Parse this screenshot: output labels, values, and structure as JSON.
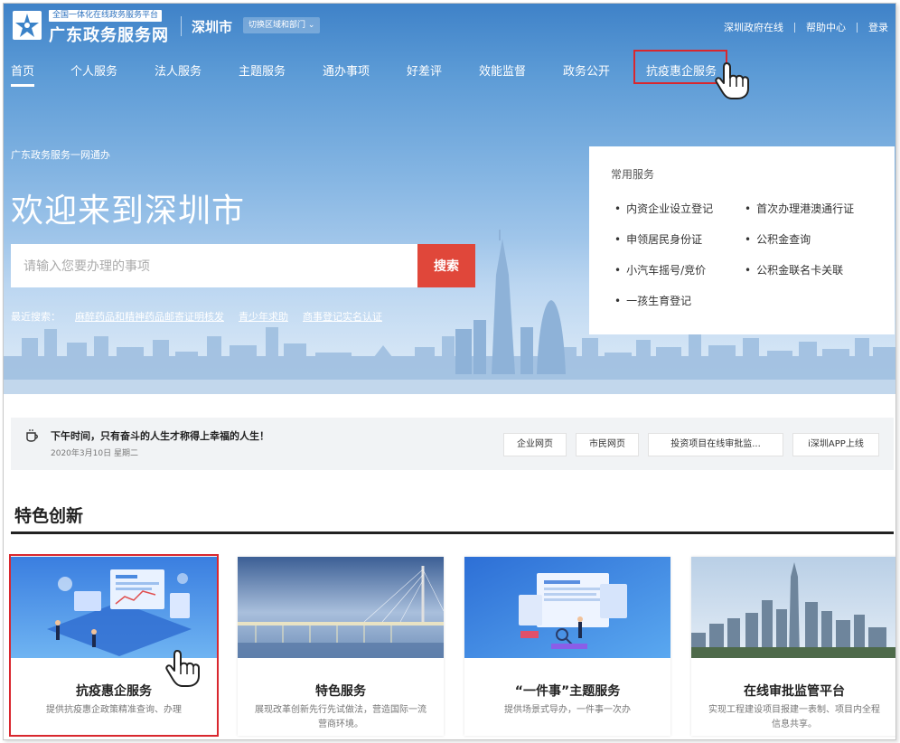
{
  "header": {
    "tagline": "全国一体化在线政务服务平台",
    "site_title": "广东政务服务网",
    "city": "深圳市",
    "switch_label": "切换区域和部门",
    "links": [
      "深圳政府在线",
      "帮助中心",
      "登录"
    ]
  },
  "nav": {
    "items": [
      "首页",
      "个人服务",
      "法人服务",
      "主题服务",
      "通办事项",
      "好差评",
      "效能监督",
      "政务公开",
      "抗疫惠企服务"
    ],
    "active": "首页",
    "highlighted": "抗疫惠企服务"
  },
  "hero": {
    "subtitle": "广东政务服务一网通办",
    "title": "欢迎来到深圳市",
    "search_placeholder": "请输入您要办理的事项",
    "search_button": "搜索",
    "recent_label": "最近搜索：",
    "recent_items": [
      "麻醉药品和精神药品邮寄证明核发",
      "青少年求助",
      "商事登记实名认证"
    ]
  },
  "common_services": {
    "title": "常用服务",
    "items": [
      "内资企业设立登记",
      "首次办理港澳通行证",
      "申领居民身份证",
      "公积金查询",
      "小汽车摇号/竞价",
      "公积金联名卡关联",
      "一孩生育登记"
    ]
  },
  "infobar": {
    "motto": "下午时间，只有奋斗的人生才称得上幸福的人生！",
    "date": "2020年3月10日 星期二",
    "quick_links": [
      "企业网页",
      "市民网页",
      "投资项目在线审批监...",
      "i深圳APP上线"
    ]
  },
  "featured": {
    "title": "特色创新",
    "cards": [
      {
        "title": "抗疫惠企服务",
        "desc": "提供抗疫惠企政策精准查询、办理"
      },
      {
        "title": "特色服务",
        "desc": "展现改革创新先行先试做法，营造国际一流营商环境。"
      },
      {
        "title": "“一件事”主题服务",
        "desc": "提供场景式导办，一件事一次办"
      },
      {
        "title": "在线审批监管平台",
        "desc": "实现工程建设项目报建一表制、项目内全程信息共享。"
      }
    ]
  },
  "colors": {
    "accent_red": "#d9272e",
    "search_button": "#e0473a",
    "hero_blue": "#4a8ccf"
  }
}
